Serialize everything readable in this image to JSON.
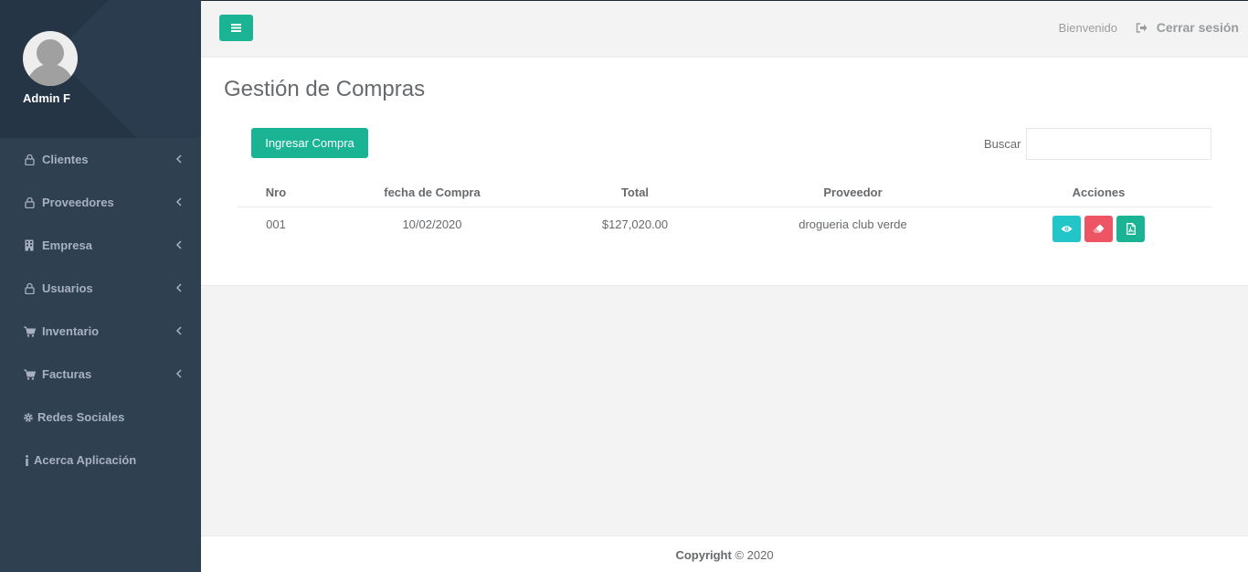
{
  "sidebar": {
    "user_name": "Admin F",
    "items": [
      {
        "label": "Clientes",
        "icon": "user-icon",
        "has_chevron": true
      },
      {
        "label": "Proveedores",
        "icon": "user-icon",
        "has_chevron": true
      },
      {
        "label": "Empresa",
        "icon": "building-icon",
        "has_chevron": true
      },
      {
        "label": "Usuarios",
        "icon": "user-icon",
        "has_chevron": true
      },
      {
        "label": "Inventario",
        "icon": "cart-icon",
        "has_chevron": true
      },
      {
        "label": "Facturas",
        "icon": "cart-icon",
        "has_chevron": true
      },
      {
        "label": "Redes Sociales",
        "icon": "gear-icon",
        "has_chevron": false
      },
      {
        "label": "Acerca Aplicación",
        "icon": "info-icon",
        "has_chevron": false
      }
    ]
  },
  "topbar": {
    "welcome": "Bienvenido",
    "logout": "Cerrar sesión"
  },
  "main": {
    "title": "Gestión de Compras",
    "add_button": "Ingresar Compra",
    "search_label": "Buscar",
    "search_value": "",
    "table": {
      "headers": [
        "Nro",
        "fecha de Compra",
        "Total",
        "Proveedor",
        "Acciones"
      ],
      "rows": [
        {
          "nro": "001",
          "fecha": "10/02/2020",
          "total": "$127,020.00",
          "proveedor": "drogueria club verde"
        }
      ]
    }
  },
  "footer": {
    "copyright_bold": "Copyright",
    "copyright_rest": " © 2020"
  },
  "colors": {
    "sidebar_bg": "#2f4050",
    "accent": "#1ab394",
    "info": "#23c6c8",
    "danger": "#ed5565"
  }
}
